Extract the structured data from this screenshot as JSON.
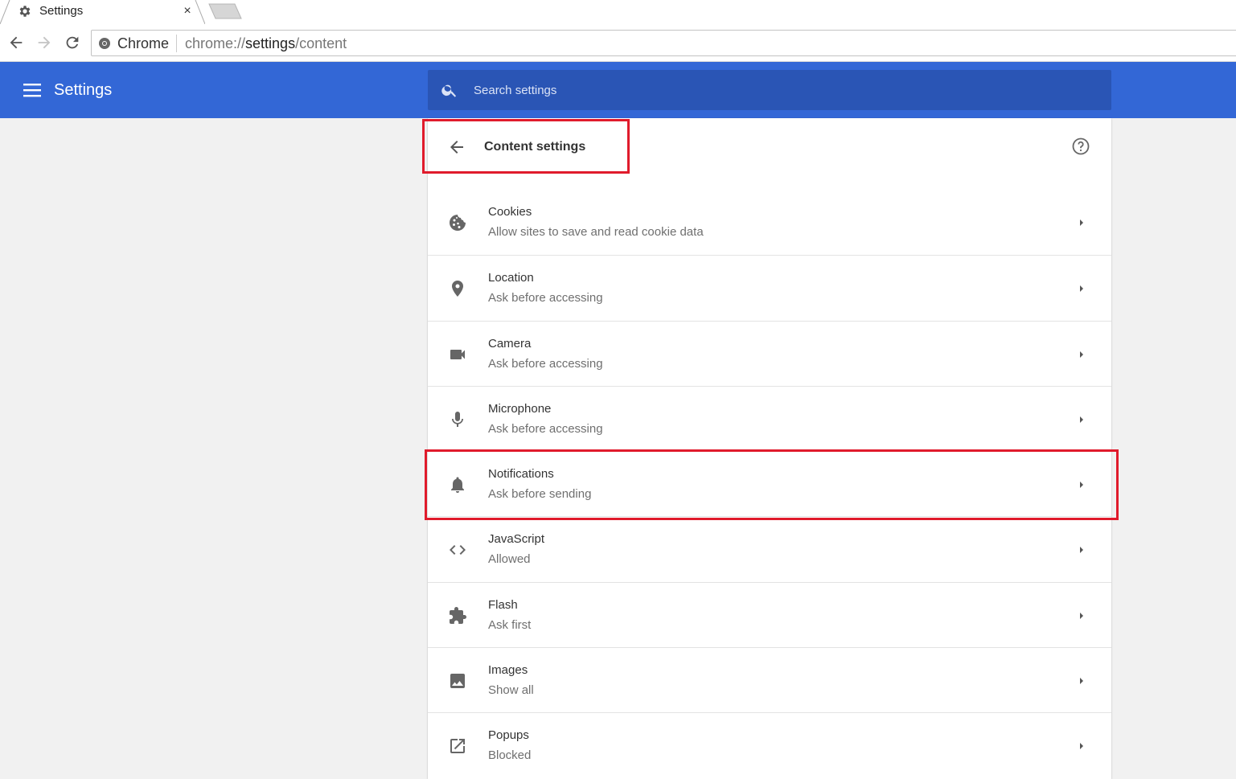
{
  "browser": {
    "tab": {
      "title": "Settings",
      "icon": "gear-icon",
      "close_label": "×"
    },
    "omnibox": {
      "chip_label": "Chrome",
      "url_prefix": "chrome://",
      "url_host": "settings",
      "url_path": "/content"
    }
  },
  "header": {
    "title": "Settings",
    "search": {
      "placeholder": "Search settings",
      "value": ""
    }
  },
  "content": {
    "title": "Content settings",
    "items": [
      {
        "title": "Cookies",
        "subtitle": "Allow sites to save and read cookie data",
        "icon": "cookie-icon"
      },
      {
        "title": "Location",
        "subtitle": "Ask before accessing",
        "icon": "location-pin-icon"
      },
      {
        "title": "Camera",
        "subtitle": "Ask before accessing",
        "icon": "camera-icon"
      },
      {
        "title": "Microphone",
        "subtitle": "Ask before accessing",
        "icon": "microphone-icon"
      },
      {
        "title": "Notifications",
        "subtitle": "Ask before sending",
        "icon": "bell-icon"
      },
      {
        "title": "JavaScript",
        "subtitle": "Allowed",
        "icon": "code-icon"
      },
      {
        "title": "Flash",
        "subtitle": "Ask first",
        "icon": "puzzle-icon"
      },
      {
        "title": "Images",
        "subtitle": "Show all",
        "icon": "image-icon"
      },
      {
        "title": "Popups",
        "subtitle": "Blocked",
        "icon": "open-external-icon"
      }
    ]
  },
  "colors": {
    "header_bg": "#3367d6",
    "search_bg": "#2a55b5",
    "highlight": "#e01b2c",
    "icon_gray": "#666666"
  }
}
